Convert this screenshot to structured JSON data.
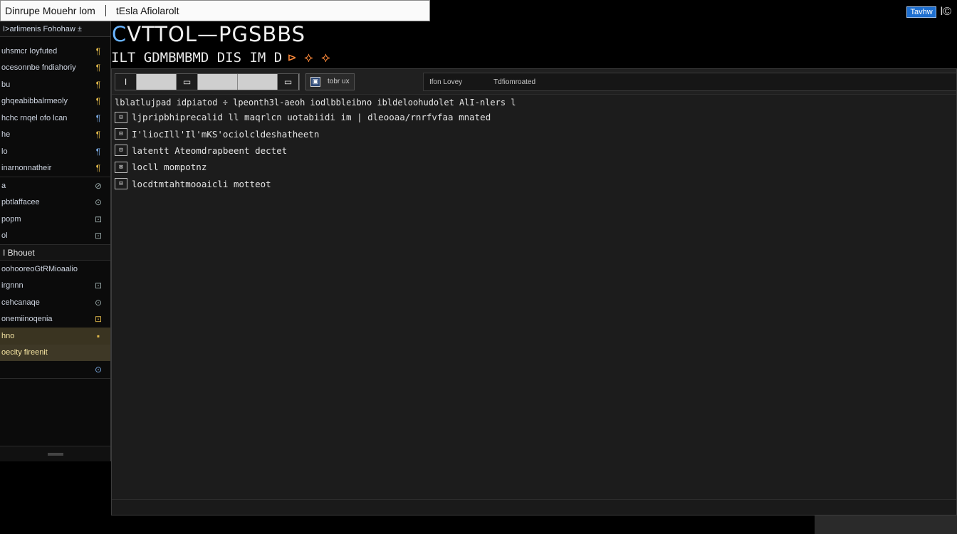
{
  "top": {
    "search_left": "Dinrupe Mouehr lom",
    "search_right": "tEsla Afiolarolt",
    "badge": "Tavhw",
    "glyph": "l©"
  },
  "app": {
    "title_prefix": "C",
    "title_rest": "VTTOL—PGSBBS",
    "subtitle": "ILT GDMBMBMD DIS IM D",
    "subtitle_accent": "⊳ ⟡ ⟡"
  },
  "sidebar": {
    "head": "I>arlimenis Fohohaw ±",
    "items_a": [
      {
        "label": "uhsmcr Ioyfuted",
        "icon": "¶"
      },
      {
        "label": "ocesonnbe fndiahoriy",
        "icon": "¶"
      },
      {
        "label": "bu",
        "icon": "¶"
      },
      {
        "label": "ghqeabibbalrmeoly",
        "icon": "¶"
      },
      {
        "label": "hchc rnqel ofo lcan",
        "icon": "¶"
      },
      {
        "label": "he",
        "icon": "¶"
      },
      {
        "label": "lo",
        "icon": "¶"
      },
      {
        "label": "inarnonnatheir",
        "icon": "¶"
      }
    ],
    "items_b": [
      {
        "label": "a",
        "icon": "⊘"
      },
      {
        "label": "pbtlaffacee",
        "icon": "⊙"
      },
      {
        "label": "popm",
        "icon": "⊡"
      },
      {
        "label": "ol",
        "icon": "⊡"
      }
    ],
    "group_title": "I Bhouet",
    "items_c": [
      {
        "label": "oohooreoGtRMioaalio",
        "icon": ""
      },
      {
        "label": "irgnnn",
        "icon": "⊡"
      },
      {
        "label": "cehcanaqe",
        "icon": "⊙"
      },
      {
        "label": "onemiinoqenia",
        "icon": "⊡"
      },
      {
        "label": "hno",
        "icon": "▪"
      },
      {
        "label": "oecity fireenit",
        "icon": ""
      },
      {
        "label": "",
        "icon": "⊙"
      }
    ]
  },
  "toolbar": {
    "btn1": "I",
    "btn2": "▭",
    "btn3": "▭",
    "seg_label": "tobr ux",
    "right_head_a": "Ifon Lovey",
    "right_head_b": "Tdfiomroated"
  },
  "content": {
    "top_line": "lblatlujpad idpiatod  ÷  lpeonth3l-aeoh iodlbbleibno ibldeloohudolet AlI-nlers l",
    "rows": [
      {
        "icon": "⊟",
        "text": "ljpripbhiprecalid ll maqrlcn uotabiidi im | dleooaa/rnrfvfaa mnated"
      },
      {
        "icon": "⊟",
        "text": "I'liocIll'Il'mKS'ociolcldeshatheetn"
      },
      {
        "icon": "⊟",
        "text": "latentt Ateomdrapbeent dectet"
      },
      {
        "icon": "⊠",
        "text": "locll mompotnz"
      },
      {
        "icon": "⊟",
        "text": "locdtmtahtmooaicli motteot"
      }
    ]
  },
  "colors": {
    "accent_blue": "#6ab4ff",
    "accent_orange": "#ff8a3a",
    "selection": "#3a3421"
  }
}
